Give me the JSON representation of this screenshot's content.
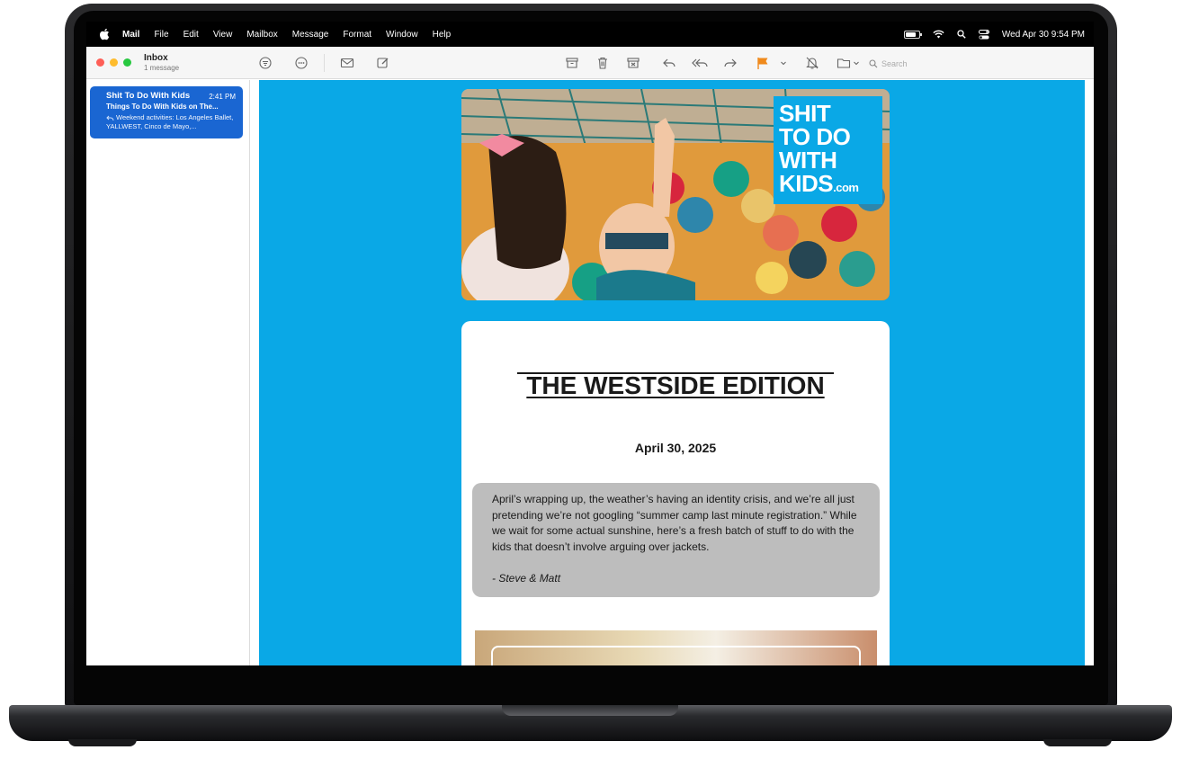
{
  "menubar": {
    "app_name": "Mail",
    "menus": [
      "File",
      "Edit",
      "View",
      "Mailbox",
      "Message",
      "Format",
      "Window",
      "Help"
    ],
    "clock": "Wed Apr 30  9:54 PM"
  },
  "toolbar": {
    "mailbox_title": "Inbox",
    "mailbox_count": "1 message",
    "search_placeholder": "Search"
  },
  "message_list": [
    {
      "sender": "Shit To Do With Kids",
      "time": "2:41 PM",
      "subject": "Things To Do With Kids on The...",
      "preview": "Weekend activities: Los Angeles Ballet, YALLWEST, Cinco de Mayo,..."
    }
  ],
  "email": {
    "logo_lines": [
      "SHIT",
      "TO DO",
      "WITH",
      "KIDS"
    ],
    "logo_suffix": ".com",
    "title": "THE WESTSIDE EDITION",
    "date": "April 30, 2025",
    "intro": "April’s wrapping up, the weather’s having an identity crisis, and we’re all just pretending we’re not googling “summer camp last minute registration.” While we wait for some actual sunshine, here’s a fresh batch of stuff to do with the kids that doesn’t involve arguing over jackets.",
    "signature": "- Steve & Matt"
  },
  "colors": {
    "email_background": "#0aa8e6",
    "selection": "#1a66d2",
    "flag": "#f08a1c"
  }
}
